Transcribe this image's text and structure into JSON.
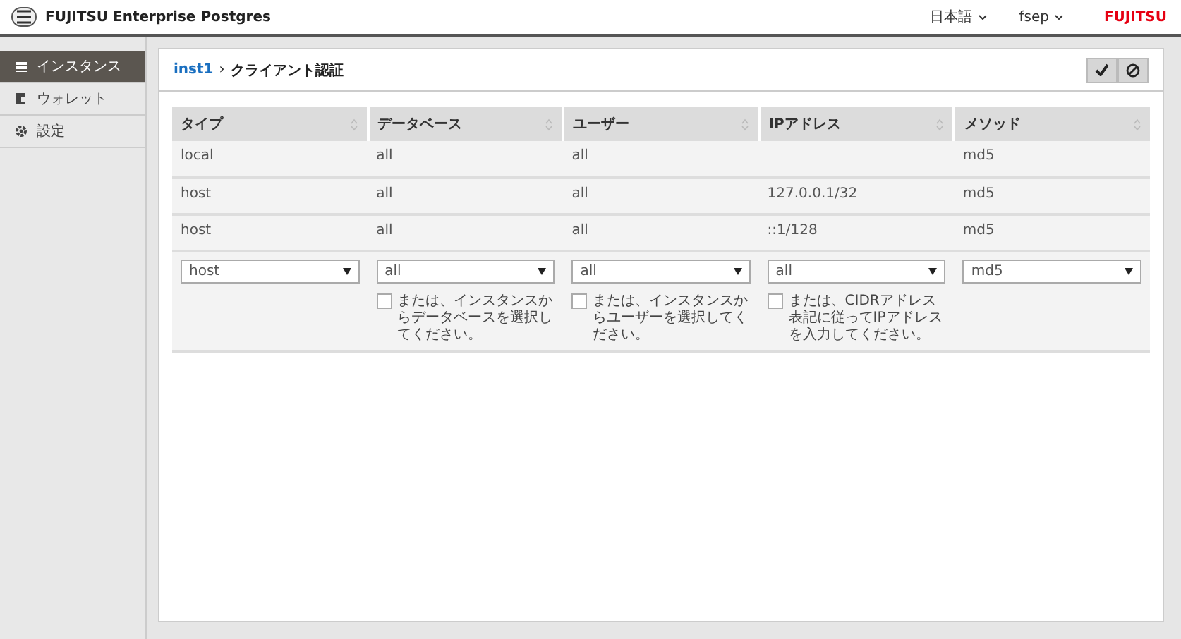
{
  "header": {
    "title": "FUJITSU Enterprise Postgres",
    "language": "日本語",
    "user": "fsep",
    "logo": "FUJITSU"
  },
  "sidebar": {
    "items": [
      {
        "label": "インスタンス",
        "selected": true
      },
      {
        "label": "ウォレット",
        "selected": false
      },
      {
        "label": "設定",
        "selected": false
      }
    ]
  },
  "breadcrumb": {
    "link": "inst1",
    "separator": "›",
    "current": "クライアント認証"
  },
  "table": {
    "columns": [
      "タイプ",
      "データベース",
      "ユーザー",
      "IPアドレス",
      "メソッド"
    ],
    "rows": [
      [
        "local",
        "all",
        "all",
        null,
        "md5"
      ],
      [
        "host",
        "all",
        "all",
        "127.0.0.1/32",
        "md5"
      ],
      [
        "host",
        "all",
        "all",
        "::1/128",
        "md5"
      ]
    ]
  },
  "new_entry": [
    {
      "select": "host"
    },
    {
      "select": "all",
      "option": {
        "label": "または、インスタンスからデータベースを選択してください。",
        "checked": false
      }
    },
    {
      "select": "all",
      "option": {
        "label": "または、インスタンスからユーザーを選択してください。",
        "checked": false
      }
    },
    {
      "select": "all",
      "option": {
        "label": "または、CIDRアドレス表記に従ってIPアドレスを入力してください。",
        "checked": false
      }
    },
    {
      "select": "md5"
    }
  ]
}
